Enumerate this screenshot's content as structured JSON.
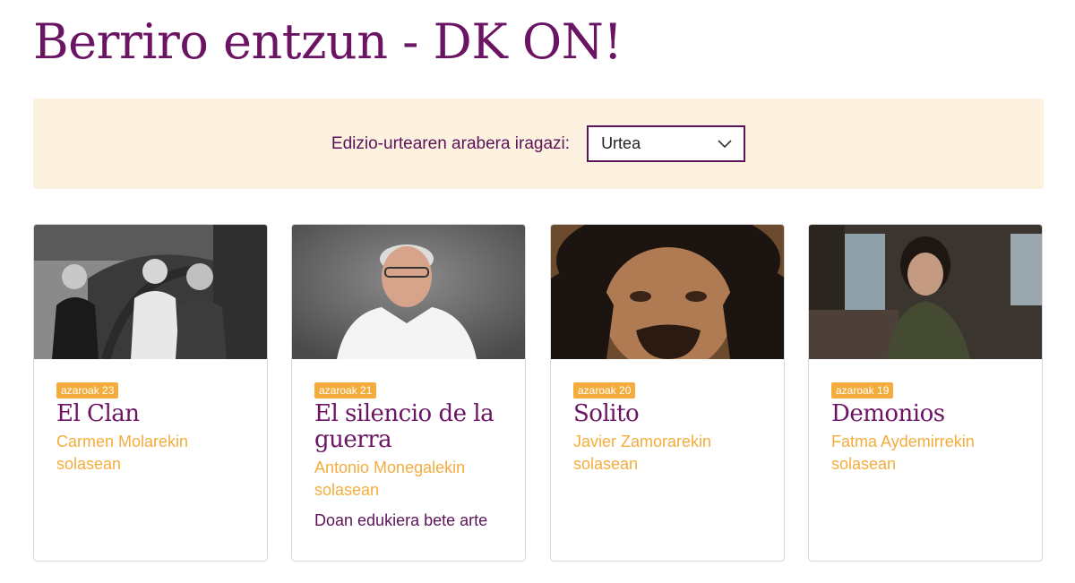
{
  "page": {
    "title": "Berriro entzun - DK ON!"
  },
  "filter": {
    "label": "Edizio-urtearen arabera iragazi:",
    "selected": "Urtea"
  },
  "cards": [
    {
      "date": "azaroak 23",
      "title": "El Clan",
      "subtitle": "Carmen Molarekin solasean",
      "note": ""
    },
    {
      "date": "azaroak 21",
      "title": "El silencio de la guerra",
      "subtitle": "Antonio Monegalekin solasean",
      "note": "Doan edukiera bete arte"
    },
    {
      "date": "azaroak 20",
      "title": "Solito",
      "subtitle": "Javier Zamorarekin solasean",
      "note": ""
    },
    {
      "date": "azaroak 19",
      "title": "Demonios",
      "subtitle": "Fatma Aydemirrekin solasean",
      "note": ""
    }
  ],
  "colors": {
    "title": "#6a1463",
    "accent": "#f4ad3d",
    "filter_bg": "#fdf1df"
  }
}
